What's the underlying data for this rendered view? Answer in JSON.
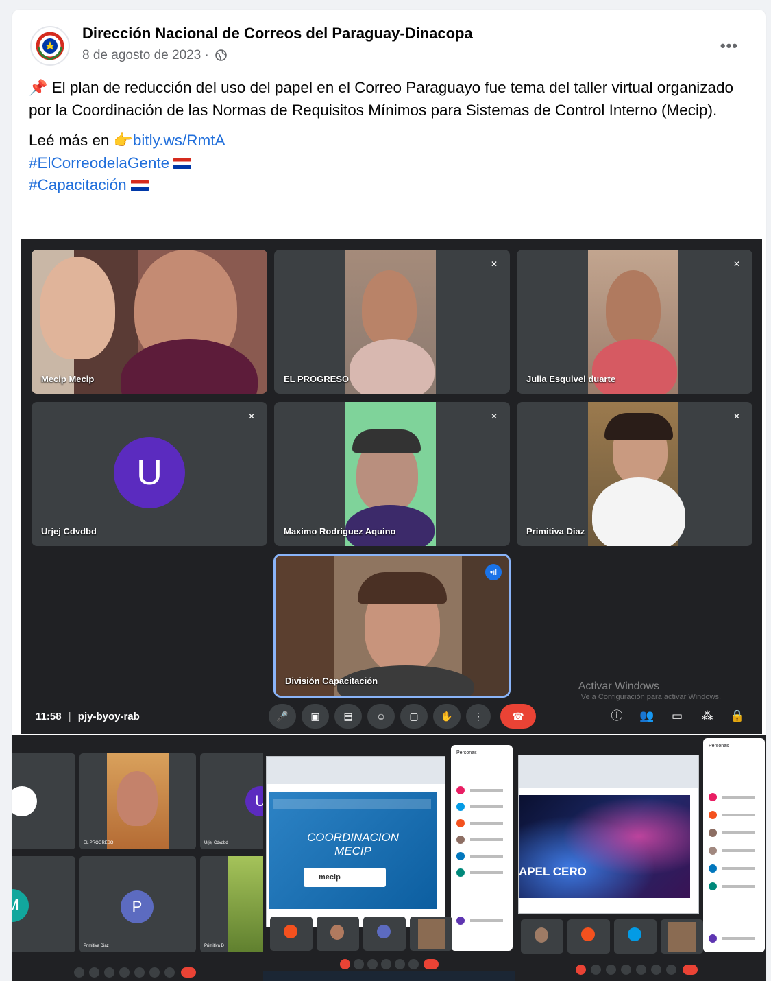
{
  "post": {
    "page_name": "Dirección Nacional de Correos del Paraguay-Dinacopa",
    "date": "8 de agosto de 2023 ·",
    "body_line1": "El plan de reducción del uso del papel en el Correo Paraguayo fue tema del taller virtual organizado por la Coordinación de las Normas de Requisitos Mínimos para Sistemas de Control Interno (Mecip).",
    "read_more": "Leé más en",
    "link": "bitly.ws/RmtA",
    "hashtag1": "#ElCorreodelaGente",
    "hashtag2": "#Capacitación",
    "more_label": "•••"
  },
  "meeting": {
    "participants": [
      {
        "name": "Mecip Mecip"
      },
      {
        "name": "EL PROGRESO"
      },
      {
        "name": "Julia Esquivel duarte"
      },
      {
        "name": "Urjej Cdvdbd",
        "initial": "U"
      },
      {
        "name": "Maximo Rodriguez Aquino"
      },
      {
        "name": "Primitiva Diaz"
      },
      {
        "name": "División Capacitación"
      }
    ],
    "time": "11:58",
    "code": "pjy-byoy-rab",
    "separator": "|",
    "watermark": "Activar Windows",
    "watermark_sub": "Ve a Configuración para activar Windows."
  },
  "thumbs": {
    "t1_names": [
      "EL PROGRESO",
      "Urjej Cdvdbd",
      "Primitiva Diaz",
      "Primitiva D"
    ],
    "t1_initials": [
      "U",
      "M",
      "P"
    ],
    "slide_title_1": "COORDINACION",
    "slide_title_2": "MECIP",
    "slide_logo": "mecip",
    "slide3_title": "APEL CERO",
    "panel_title": "Personas",
    "panel_title_3": "Personas"
  },
  "colors": {
    "link": "#216fdb",
    "meet_bg": "#202124",
    "tile_bg": "#3c4043",
    "u_avatar": "#5b2bbf",
    "end_call": "#ea4335"
  }
}
